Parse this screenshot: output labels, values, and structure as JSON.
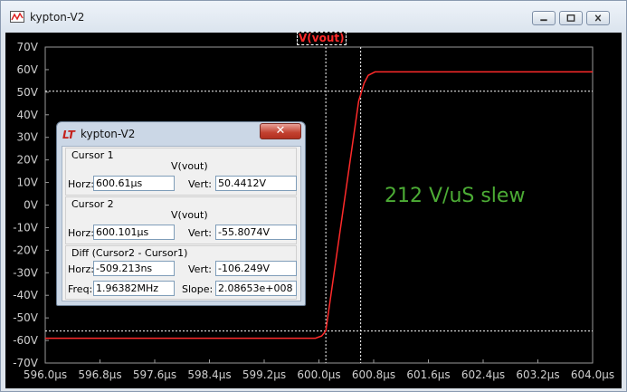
{
  "window": {
    "title": "kypton-V2"
  },
  "plot": {
    "trace_label": "V(vout)",
    "annotation": "212 V/uS slew",
    "colors": {
      "background": "#000000",
      "trace": "#ff2a2a",
      "annotation": "#4cac35",
      "grid": "#ffffff"
    }
  },
  "chart_data": {
    "type": "line",
    "title": "V(vout)",
    "xlabel": "",
    "ylabel": "",
    "x_ticks": [
      "596.0µs",
      "596.8µs",
      "597.6µs",
      "598.4µs",
      "599.2µs",
      "600.0µs",
      "600.8µs",
      "601.6µs",
      "602.4µs",
      "603.2µs",
      "604.0µs"
    ],
    "y_ticks": [
      "70V",
      "60V",
      "50V",
      "40V",
      "30V",
      "20V",
      "10V",
      "0V",
      "-10V",
      "-20V",
      "-30V",
      "-40V",
      "-50V",
      "-60V",
      "-70V"
    ],
    "xlim_us": [
      596.0,
      604.0
    ],
    "ylim_V": [
      -70,
      70
    ],
    "series": [
      {
        "name": "V(vout)",
        "x_us": [
          596.0,
          599.95,
          600.04,
          600.1,
          600.34,
          600.58,
          600.66,
          600.72,
          600.82,
          604.0
        ],
        "y_V": [
          -59,
          -59,
          -58,
          -55.8,
          -5,
          46,
          54,
          57.5,
          59,
          59
        ]
      }
    ],
    "cursors": [
      {
        "x_us": 600.61,
        "y_V": 50.4412
      },
      {
        "x_us": 600.101,
        "y_V": -55.8074
      }
    ],
    "grid": false
  },
  "dialog": {
    "title": "kypton-V2",
    "close_glyph": "✕",
    "cursor1": {
      "header": "Cursor 1",
      "signal": "V(vout)",
      "horz_label": "Horz:",
      "horz": "600.61µs",
      "vert_label": "Vert:",
      "vert": "50.4412V"
    },
    "cursor2": {
      "header": "Cursor 2",
      "signal": "V(vout)",
      "horz_label": "Horz:",
      "horz": "600.101µs",
      "vert_label": "Vert:",
      "vert": "-55.8074V"
    },
    "diff": {
      "header": "Diff (Cursor2 - Cursor1)",
      "horz_label": "Horz:",
      "horz": "-509.213ns",
      "vert_label": "Vert:",
      "vert": "-106.249V",
      "freq_label": "Freq:",
      "freq": "1.96382MHz",
      "slope_label": "Slope:",
      "slope": "2.08653e+008"
    }
  }
}
